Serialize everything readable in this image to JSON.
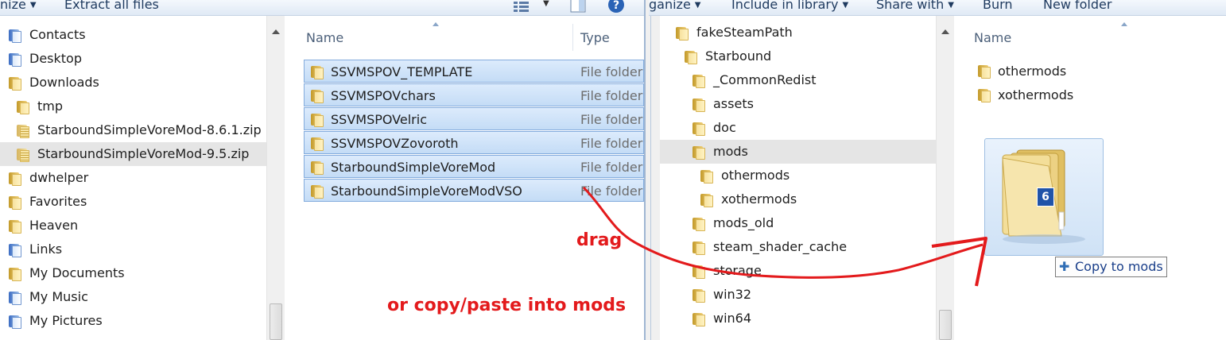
{
  "left_window": {
    "toolbar": {
      "organize_label": "nize",
      "extract_label": "Extract all files"
    },
    "tree": [
      {
        "label": "Contacts",
        "icon": "contacts-icon"
      },
      {
        "label": "Desktop",
        "icon": "desktop-icon"
      },
      {
        "label": "Downloads",
        "icon": "folder-icon"
      },
      {
        "label": "tmp",
        "icon": "folder-icon"
      },
      {
        "label": "StarboundSimpleVoreMod-8.6.1.zip",
        "icon": "zip-folder-icon"
      },
      {
        "label": "StarboundSimpleVoreMod-9.5.zip",
        "icon": "zip-folder-icon",
        "selected": true
      },
      {
        "label": "dwhelper",
        "icon": "folder-icon"
      },
      {
        "label": "Favorites",
        "icon": "folder-icon"
      },
      {
        "label": "Heaven",
        "icon": "folder-icon"
      },
      {
        "label": "Links",
        "icon": "folder-icon"
      },
      {
        "label": "My Documents",
        "icon": "folder-icon"
      },
      {
        "label": "My Music",
        "icon": "folder-icon"
      },
      {
        "label": "My Pictures",
        "icon": "folder-icon"
      }
    ],
    "columns": {
      "name": "Name",
      "type": "Type"
    },
    "files": [
      {
        "name": "SSVMSPOV_TEMPLATE",
        "type": "File folder"
      },
      {
        "name": "SSVMSPOVchars",
        "type": "File folder"
      },
      {
        "name": "SSVMSPOVelric",
        "type": "File folder"
      },
      {
        "name": "SSVMSPOVZovoroth",
        "type": "File folder"
      },
      {
        "name": "StarboundSimpleVoreMod",
        "type": "File folder"
      },
      {
        "name": "StarboundSimpleVoreModVSO",
        "type": "File folder"
      }
    ]
  },
  "right_window": {
    "toolbar": {
      "organize_label": "ganize",
      "include_label": "Include in library",
      "share_label": "Share with",
      "burn_label": "Burn",
      "new_folder_label": "New folder"
    },
    "tree": [
      {
        "label": "fakeSteamPath"
      },
      {
        "label": "Starbound"
      },
      {
        "label": "_CommonRedist"
      },
      {
        "label": "assets"
      },
      {
        "label": "doc"
      },
      {
        "label": "mods",
        "selected": true
      },
      {
        "label": "othermods"
      },
      {
        "label": "xothermods"
      },
      {
        "label": "mods_old"
      },
      {
        "label": "steam_shader_cache"
      },
      {
        "label": "storage"
      },
      {
        "label": "win32"
      },
      {
        "label": "win64"
      }
    ],
    "columns": {
      "name": "Name"
    },
    "files": [
      {
        "name": "othermods"
      },
      {
        "name": "xothermods"
      }
    ],
    "drag_badge": "6",
    "copy_tooltip": "Copy to mods"
  },
  "annotations": {
    "drag": "drag",
    "copy_paste": "or copy/paste into mods",
    "color": "#e31a1c"
  },
  "colors": {
    "selection_fill": "#c4dcf6",
    "selection_border": "#84acdd",
    "toolbar_text": "#1e3a5f"
  }
}
